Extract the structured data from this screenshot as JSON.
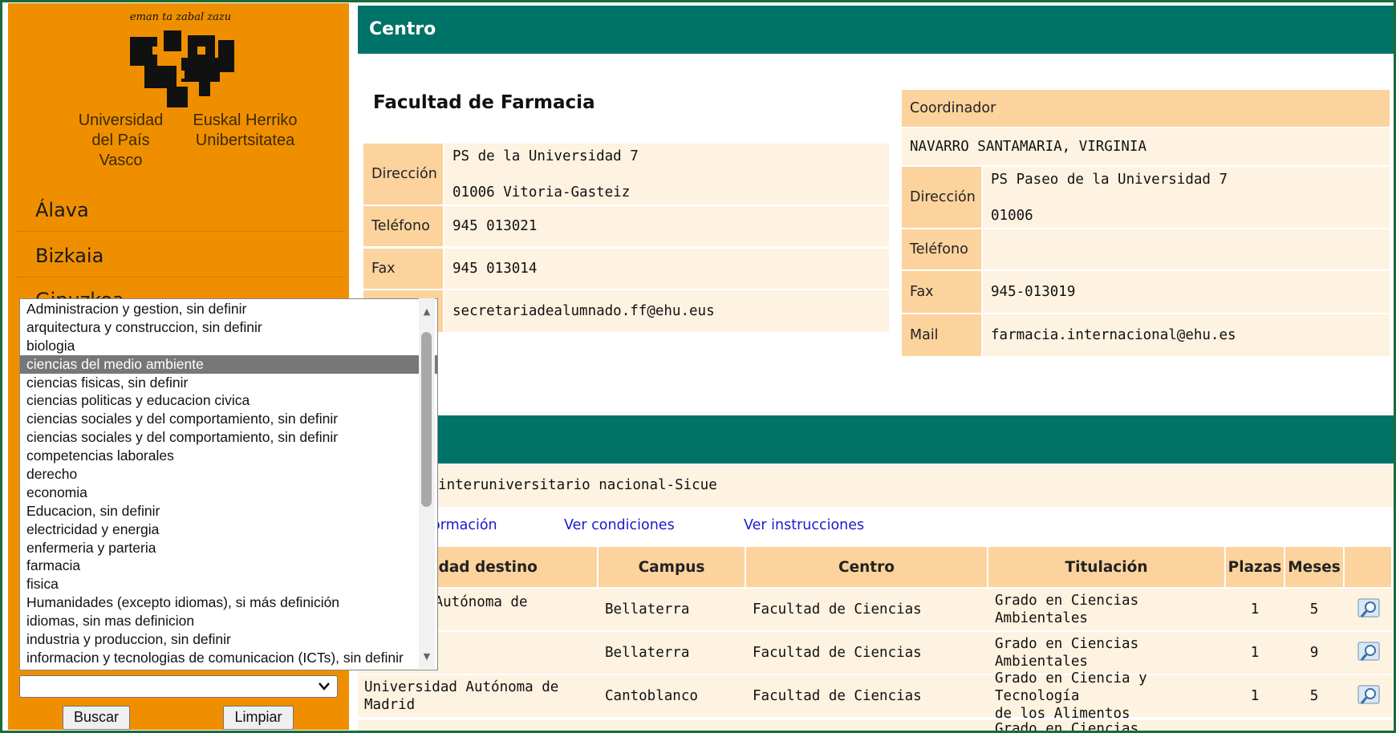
{
  "sidebar": {
    "motto": "eman ta zabal zazu",
    "university_es_line1": "Universidad",
    "university_es_line2": "del País Vasco",
    "university_eu_line1": "Euskal Herriko",
    "university_eu_line2": "Unibertsitatea",
    "nav": [
      "Álava",
      "Bizkaia",
      "Gipuzkoa"
    ],
    "list_options": [
      "Administracion y gestion, sin definir",
      "arquitectura y construccion, sin definir",
      "biologia",
      "ciencias del medio ambiente",
      "ciencias fisicas, sin definir",
      "ciencias politicas y educacion civica",
      "ciencias sociales y del comportamiento, sin definir",
      "ciencias sociales y del comportamiento, sin definir",
      "competencias laborales",
      "derecho",
      "economia",
      "Educacion, sin definir",
      "electricidad y energia",
      "enfermeria y parteria",
      "farmacia",
      "fisica",
      "Humanidades (excepto idiomas), si más definición",
      "idiomas, sin mas definicion",
      "industria y produccion, sin definir",
      "informacion y tecnologias de comunicacion (ICTs), sin definir"
    ],
    "selected_option": "ciencias del medio ambiente",
    "select_value": "",
    "buscar_label": "Buscar",
    "limpiar_label": "Limpiar"
  },
  "centro": {
    "header": "Centro",
    "name": "Facultad de Farmacia",
    "direccion_label": "Dirección",
    "direccion_line1": "PS de la Universidad  7",
    "direccion_line2": "01006 Vitoria-Gasteiz",
    "telefono_label": "Teléfono",
    "telefono": "945 013021",
    "fax_label": "Fax",
    "fax": "945 013014",
    "mail": "secretariadealumnado.ff@ehu.eus"
  },
  "coordinador": {
    "header": "Coordinador",
    "name": "NAVARRO SANTAMARIA, VIRGINIA",
    "direccion_label": "Dirección",
    "direccion_line1": "PS Paseo de la Universidad  7",
    "direccion_line2": "01006",
    "telefono_label": "Teléfono",
    "telefono": "",
    "fax_label": "Fax",
    "fax": "945-013019",
    "mail_label": "Mail",
    "mail": "farmacia.internacional@ehu.es"
  },
  "programa": {
    "name_visible": "n interuniversitario nacional-Sicue",
    "link_info": "ormación",
    "link_condiciones": "Ver condiciones",
    "link_instrucciones": "Ver instrucciones",
    "columns": [
      "rsidad destino",
      "Campus",
      "Centro",
      "Titulación",
      "Plazas",
      "Meses"
    ],
    "rows": [
      {
        "universidad_l1": "ad Autónoma de",
        "universidad_l2": "",
        "campus": "Bellaterra",
        "centro": "Facultad de Ciencias",
        "titulacion_l1": "Grado en Ciencias",
        "titulacion_l2": "Ambientales",
        "plazas": "1",
        "meses": "5"
      },
      {
        "universidad_l1": "",
        "universidad_l2": "",
        "campus": "Bellaterra",
        "centro": "Facultad de Ciencias",
        "titulacion_l1": "Grado en Ciencias",
        "titulacion_l2": "Ambientales",
        "plazas": "1",
        "meses": "9"
      },
      {
        "universidad_l1": "Universidad Autónoma de",
        "universidad_l2": "Madrid",
        "campus": "Cantoblanco",
        "centro": "Facultad de Ciencias",
        "titulacion_l1": "Grado en Ciencia y Tecnología",
        "titulacion_l2": "de los Alimentos",
        "plazas": "1",
        "meses": "5"
      }
    ],
    "partial_next_row": "Grado en Ciencias"
  },
  "colors": {
    "sidebar": "#ef8f00",
    "header_bar": "#007368",
    "label_bg": "#fcd39d",
    "value_bg": "#fef2e1",
    "link": "#1a1acc"
  },
  "icons": {
    "logo": "ehu-logo",
    "zoom": "magnifier-icon"
  }
}
